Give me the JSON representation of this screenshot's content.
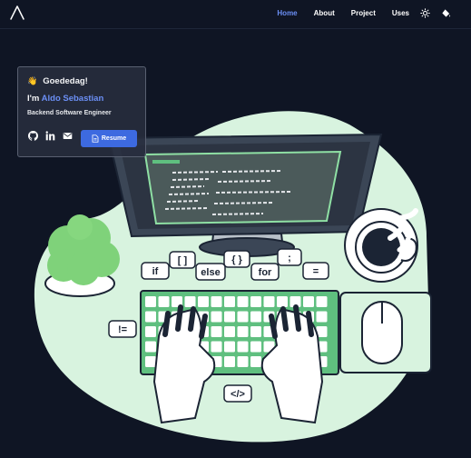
{
  "nav": {
    "logo_icon": "triangle-logo-icon",
    "links": [
      {
        "label": "Home",
        "active": true
      },
      {
        "label": "About",
        "active": false
      },
      {
        "label": "Project",
        "active": false
      },
      {
        "label": "Uses",
        "active": false
      }
    ],
    "theme_icon": "sun-icon",
    "paint_icon": "paint-bucket-icon"
  },
  "hero": {
    "greeting": "Goededag!",
    "greeting_icon": "waving-hand-icon",
    "intro_prefix": "I'm ",
    "name": "Aldo Sebastian",
    "role": "Backend Software Engineer",
    "socials": [
      "github-icon",
      "linkedin-icon",
      "mail-icon"
    ],
    "resume_label": "Resume",
    "resume_icon": "document-icon"
  },
  "illustration": {
    "bubbles": [
      "if",
      "[ ]",
      "else",
      "{ }",
      "for",
      ";",
      "=",
      "!=",
      "</>"
    ]
  },
  "colors": {
    "background": "#0f1524",
    "accent": "#6b8ff5",
    "button": "#3d6ae0",
    "illustration_green": "#5fbf7f",
    "illustration_mint": "#d8f3df"
  }
}
